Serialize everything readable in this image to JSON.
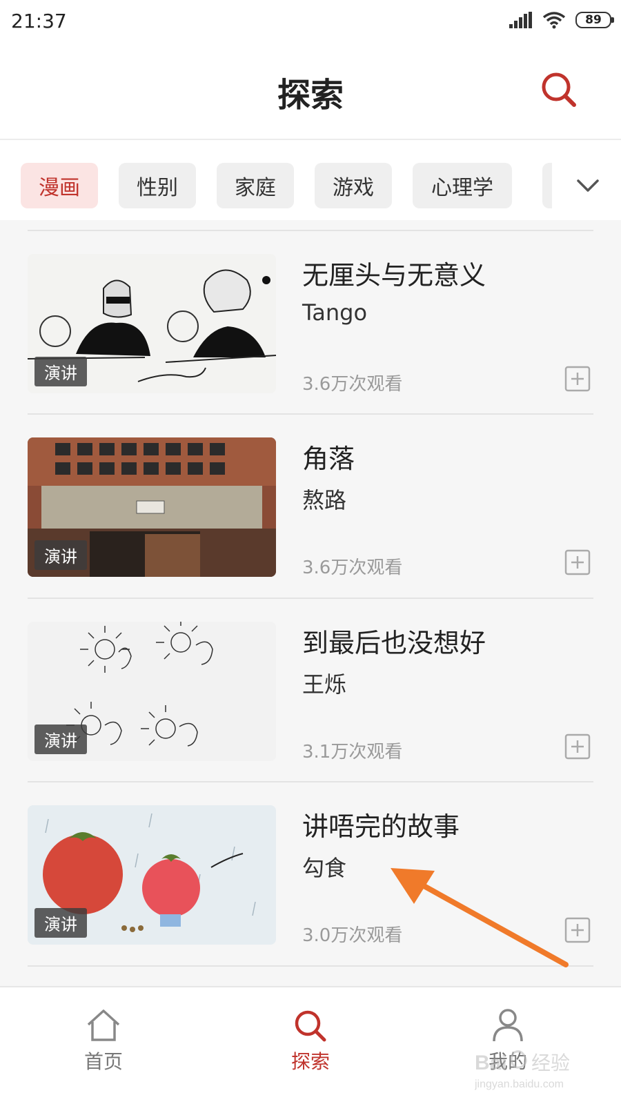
{
  "status_bar": {
    "time": "21:37",
    "battery": "89"
  },
  "header": {
    "title": "探索",
    "search_icon": "search-icon"
  },
  "tabs": [
    {
      "label": "漫画",
      "active": true
    },
    {
      "label": "性别",
      "active": false
    },
    {
      "label": "家庭",
      "active": false
    },
    {
      "label": "游戏",
      "active": false
    },
    {
      "label": "心理学",
      "active": false
    }
  ],
  "tabs_more_icon": "chevron-down-icon",
  "items": [
    {
      "title": "无厘头与无意义",
      "author": "Tango",
      "views": "3.6万次观看",
      "badge": "演讲"
    },
    {
      "title": "角落",
      "author": "熬路",
      "views": "3.6万次观看",
      "badge": "演讲"
    },
    {
      "title": "到最后也没想好",
      "author": "王烁",
      "views": "3.1万次观看",
      "badge": "演讲"
    },
    {
      "title": "讲唔完的故事",
      "author": "勾食",
      "views": "3.0万次观看",
      "badge": "演讲"
    }
  ],
  "bottom_nav": [
    {
      "label": "首页",
      "icon": "home-icon",
      "active": false
    },
    {
      "label": "探索",
      "icon": "search-icon",
      "active": true
    },
    {
      "label": "我的",
      "icon": "user-icon",
      "active": false
    }
  ],
  "colors": {
    "accent": "#c0332c",
    "annotation_arrow": "#f07a2a"
  }
}
